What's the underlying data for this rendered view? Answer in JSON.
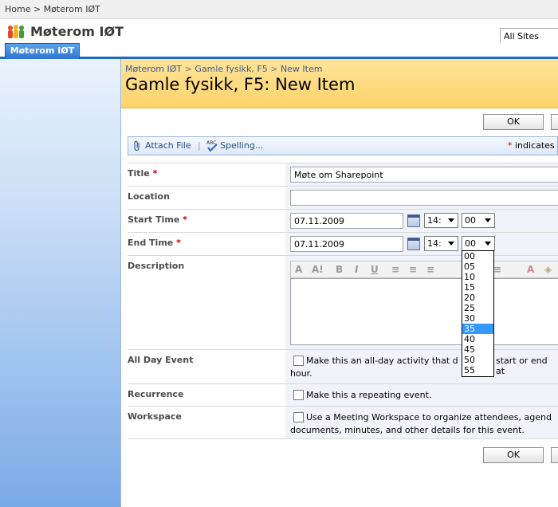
{
  "topbar": {
    "home": "Home",
    "separator": ">",
    "site": "Møterom IØT"
  },
  "site": {
    "title": "Møterom IØT",
    "scope": "All Sites"
  },
  "tabs": [
    {
      "label": "Møterom IØT"
    }
  ],
  "titlearea": {
    "breadcrumb": [
      "Møterom IØT",
      "Gamle fysikk, F5",
      "New Item"
    ],
    "breadcrumb_sep": ">",
    "title": "Gamle fysikk, F5: New Item"
  },
  "buttons": {
    "ok": "OK"
  },
  "toolbar": {
    "attach": "Attach File",
    "divider": "|",
    "spelling": "Spelling...",
    "required_star": "*",
    "required_note": "indicates a"
  },
  "form": {
    "required_star": "*",
    "title": {
      "label": "Title",
      "value": "Møte om Sharepoint"
    },
    "location": {
      "label": "Location",
      "value": ""
    },
    "start": {
      "label": "Start Time",
      "date": "07.11.2009",
      "hour": "14:",
      "minute": "00"
    },
    "end": {
      "label": "End Time",
      "date": "07.11.2009",
      "hour": "14:",
      "minute": "00"
    },
    "description": {
      "label": "Description",
      "toolbar": [
        "A",
        "A!",
        "B",
        "I",
        "U"
      ]
    },
    "all_day": {
      "label": "All Day Event",
      "text_line1": "Make this an all-day activity that d",
      "text_line1_tail": "start or end at",
      "text_line2": "hour."
    },
    "recurrence": {
      "label": "Recurrence",
      "text": "Make this a repeating event."
    },
    "workspace": {
      "label": "Workspace",
      "text_line1": "Use a Meeting Workspace to organize attendees, agend",
      "text_line2": "documents, minutes, and other details for this event."
    }
  },
  "minute_options": [
    "00",
    "05",
    "10",
    "15",
    "20",
    "25",
    "30",
    "35",
    "40",
    "45",
    "50",
    "55"
  ],
  "minute_highlighted": "35"
}
